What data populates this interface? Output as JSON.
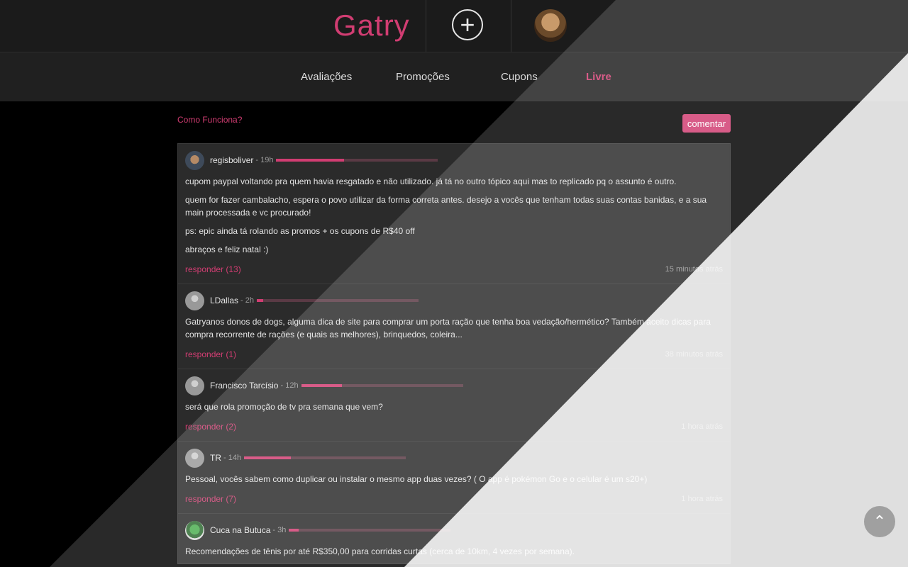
{
  "header": {
    "logo": "Gatry",
    "add_symbol": "+"
  },
  "nav": {
    "items": [
      {
        "label": "Avaliações"
      },
      {
        "label": "Promoções"
      },
      {
        "label": "Cupons"
      },
      {
        "label": "Livre"
      }
    ],
    "active": "Livre"
  },
  "toolbar": {
    "how_it_works": "Como Funciona?",
    "comment_button": "comentar"
  },
  "posts": [
    {
      "user": "regisboliver",
      "level": "- 19h",
      "level_fraction": 0.42,
      "paragraphs": [
        "cupom paypal voltando pra quem havia resgatado e não utilizado. já tá no outro tópico aqui mas to replicado pq o assunto é outro.",
        "quem for fazer cambalacho, espera o povo utilizar da forma correta antes. desejo a vocês que tenham todas suas contas banidas, e a sua main processada e vc procurado!",
        "ps: epic ainda tá rolando as promos + os cupons de R$40 off",
        "abraços e feliz natal :)"
      ],
      "reply": "responder (13)",
      "ago": "15 minutos atrás"
    },
    {
      "user": "LDallas",
      "level": "- 2h",
      "level_fraction": 0.04,
      "paragraphs": [
        "Gatryanos donos de dogs, alguma dica de site para comprar um porta ração que tenha boa vedação/hermético? Também aceito dicas para compra recorrente de rações (e quais as melhores), brinquedos, coleira..."
      ],
      "reply": "responder (1)",
      "ago": "38 minutos atrás"
    },
    {
      "user": "Francisco Tarcísio",
      "level": "- 12h",
      "level_fraction": 0.25,
      "paragraphs": [
        "será que rola promoção de tv pra semana que vem?"
      ],
      "reply": "responder (2)",
      "ago": "1 hora atrás"
    },
    {
      "user": "TR",
      "level": "- 14h",
      "level_fraction": 0.29,
      "paragraphs": [
        "Pessoal, vocês sabem como duplicar ou instalar o mesmo app duas vezes? ( O app é pokémon Go e o celular é um s20+)"
      ],
      "reply": "responder (7)",
      "ago": "1 hora atrás"
    },
    {
      "user": "Cuca na Butuca",
      "level": "- 3h",
      "level_fraction": 0.06,
      "paragraphs": [
        "Recomendações de tênis por até R$350,00 para corridas curtas (cerca de 10km, 4 vezes por semana)."
      ],
      "reply": "",
      "ago": ""
    }
  ],
  "scroll_top_symbol": "⌃"
}
